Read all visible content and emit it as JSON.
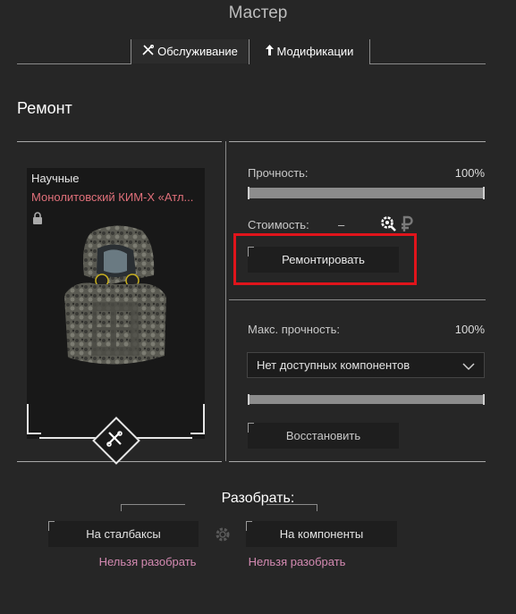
{
  "window": {
    "title": "Мастер"
  },
  "tabs": [
    {
      "label": "Обслуживание",
      "icon": "tools-icon",
      "active": true
    },
    {
      "label": "Модификации",
      "icon": "upgrade-arrow-icon",
      "active": false
    }
  ],
  "section_title": "Ремонт",
  "item": {
    "category": "Научные",
    "name": "Монолитовский КИМ-Х «Атл...",
    "locked": true,
    "name_color": "#e0707a",
    "badge_icon": "tools-icon"
  },
  "repair": {
    "durability_label": "Прочность:",
    "durability_value": "100%",
    "durability_fraction": 1.0,
    "cost_label": "Стоимость:",
    "cost_value": "–",
    "cost_icons": [
      "search-gear-icon",
      "ruble-icon"
    ],
    "repair_button": "Ремонтировать",
    "highlight_color": "#e0141b"
  },
  "restore": {
    "max_durability_label": "Макс. прочность:",
    "max_durability_value": "100%",
    "max_durability_fraction": 1.0,
    "component_select": "Нет доступных компонентов",
    "restore_button": "Восстановить"
  },
  "disassemble": {
    "title": "Разобрать:",
    "to_stalbucks_button": "На сталбаксы",
    "to_components_button": "На компоненты",
    "stalbucks_note": "Нельзя разобрать",
    "components_note": "Нельзя разобрать",
    "note_color": "#d48ab2"
  }
}
